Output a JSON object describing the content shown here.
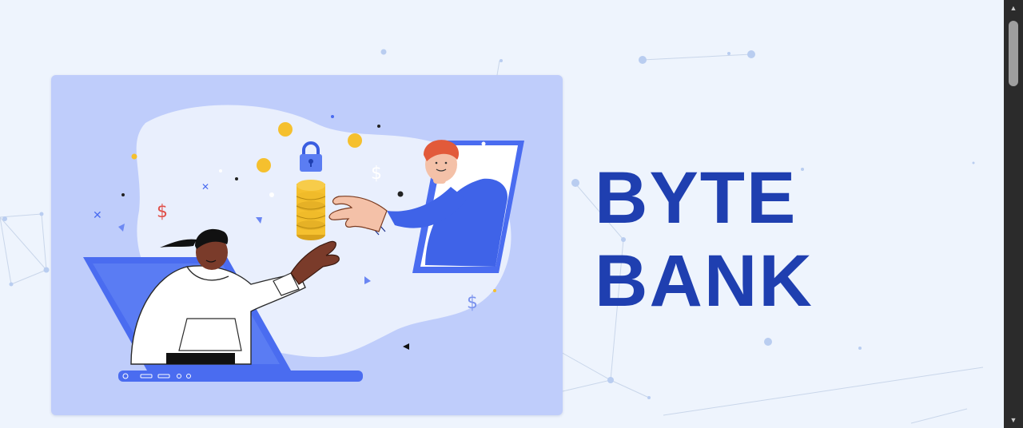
{
  "brand": {
    "title_line1": "BYTE",
    "title_line2": "BANK"
  },
  "illustration": {
    "description_icons": [
      "laptop-icon",
      "phone-icon",
      "padlock-icon",
      "coin-stack-icon",
      "dollar-sign-icon"
    ],
    "dollar_symbol": "$"
  },
  "scrollbar": {
    "up_glyph": "▲",
    "down_glyph": "▼"
  },
  "colors": {
    "background": "#eef4fd",
    "card": "#bfcdfb",
    "brand_blue": "#1f3fb0",
    "accent_blue": "#4a6cf0",
    "coin_gold": "#f5c02e"
  }
}
